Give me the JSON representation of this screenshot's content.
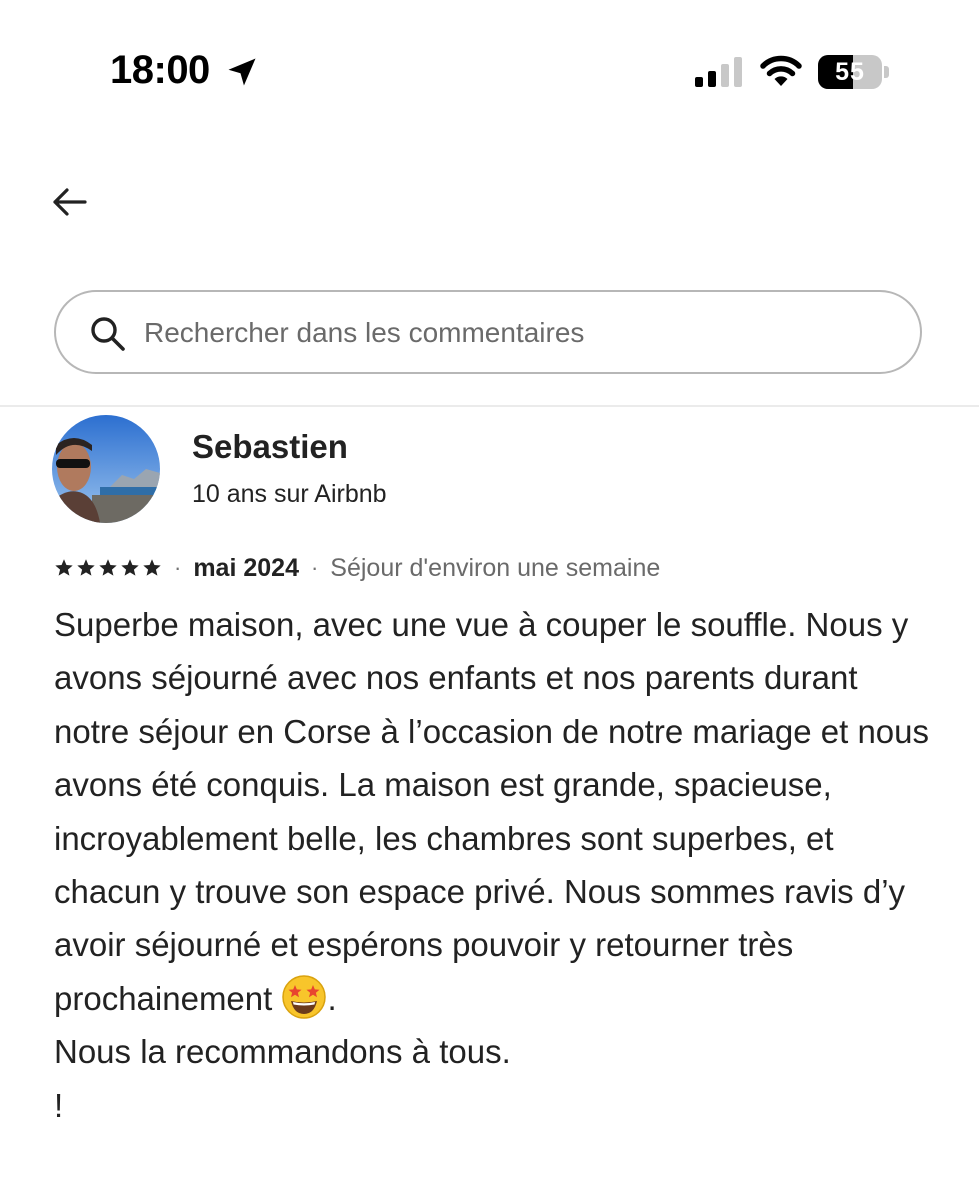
{
  "status_bar": {
    "time": "18:00",
    "battery_percent": "55",
    "battery_level": 0.55,
    "icons": [
      "location-arrow-icon",
      "cellular-signal-icon",
      "wifi-icon",
      "battery-icon"
    ]
  },
  "nav": {
    "back_icon": "arrow-left-icon"
  },
  "search": {
    "placeholder": "Rechercher dans les commentaires",
    "value": "",
    "icon": "search-icon"
  },
  "review": {
    "reviewer_name": "Sebastien",
    "reviewer_meta": "10 ans sur Airbnb",
    "rating": 5,
    "rating_max": 5,
    "date": "mai 2024",
    "stay": "Séjour d'environ une semaine",
    "separator": "·",
    "body": {
      "paragraph_1": "Superbe maison, avec une vue à couper le souffle. Nous y avons séjourné avec nos enfants et nos parents durant notre séjour en Corse à l’occasion de notre mariage et nous avons été conquis. La maison est grande, spacieuse, incroyablement belle, les chambres sont superbes, et chacun y trouve son espace privé. Nous sommes ravis d’y avoir séjourné et espérons pouvoir y retourner très prochainement",
      "emoji": "star-struck-emoji",
      "paragraph_1_end": ".",
      "paragraph_2": "Nous la recommandons à tous.",
      "paragraph_3": "!"
    }
  },
  "colors": {
    "text": "#222222",
    "secondary_text": "#6a6a6a",
    "border": "#b7b7b7",
    "divider": "#ebebeb",
    "background": "#ffffff"
  }
}
